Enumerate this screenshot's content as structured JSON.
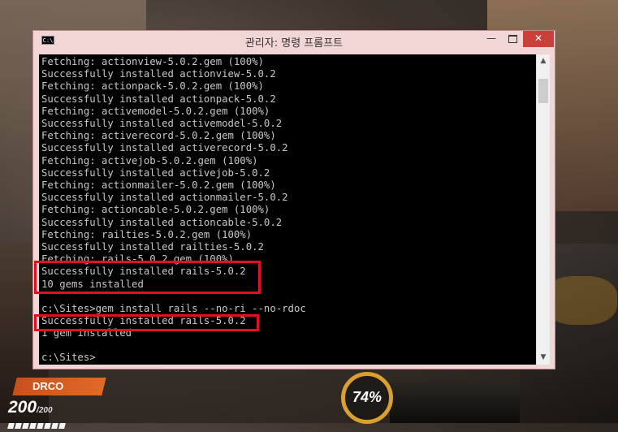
{
  "window": {
    "title": "관리자: 명령 프롬프트",
    "icon_label": "C:\\",
    "controls": {
      "minimize": "—",
      "close": "✕"
    }
  },
  "console": {
    "lines": [
      "Fetching: actionview-5.0.2.gem (100%)",
      "Successfully installed actionview-5.0.2",
      "Fetching: actionpack-5.0.2.gem (100%)",
      "Successfully installed actionpack-5.0.2",
      "Fetching: activemodel-5.0.2.gem (100%)",
      "Successfully installed activemodel-5.0.2",
      "Fetching: activerecord-5.0.2.gem (100%)",
      "Successfully installed activerecord-5.0.2",
      "Fetching: activejob-5.0.2.gem (100%)",
      "Successfully installed activejob-5.0.2",
      "Fetching: actionmailer-5.0.2.gem (100%)",
      "Successfully installed actionmailer-5.0.2",
      "Fetching: actioncable-5.0.2.gem (100%)",
      "Successfully installed actioncable-5.0.2",
      "Fetching: railties-5.0.2.gem (100%)",
      "Successfully installed railties-5.0.2",
      "Fetching: rails-5.0.2.gem (100%)",
      "Successfully installed rails-5.0.2",
      "10 gems installed",
      "",
      "c:\\Sites>gem install rails --no-ri --no-rdoc",
      "Successfully installed rails-5.0.2",
      "1 gem installed",
      "",
      "c:\\Sites>"
    ],
    "text_color": "#c8c8c8",
    "background": "#000000"
  },
  "scrollbar": {
    "up_arrow": "▲",
    "down_arrow": "▼"
  },
  "highlight_color": "#e01020",
  "hud": {
    "player_name": "DRCO",
    "health_current": "200",
    "health_max": "200",
    "ultimate_charge": "74%",
    "accent_color": "#d9a030"
  }
}
